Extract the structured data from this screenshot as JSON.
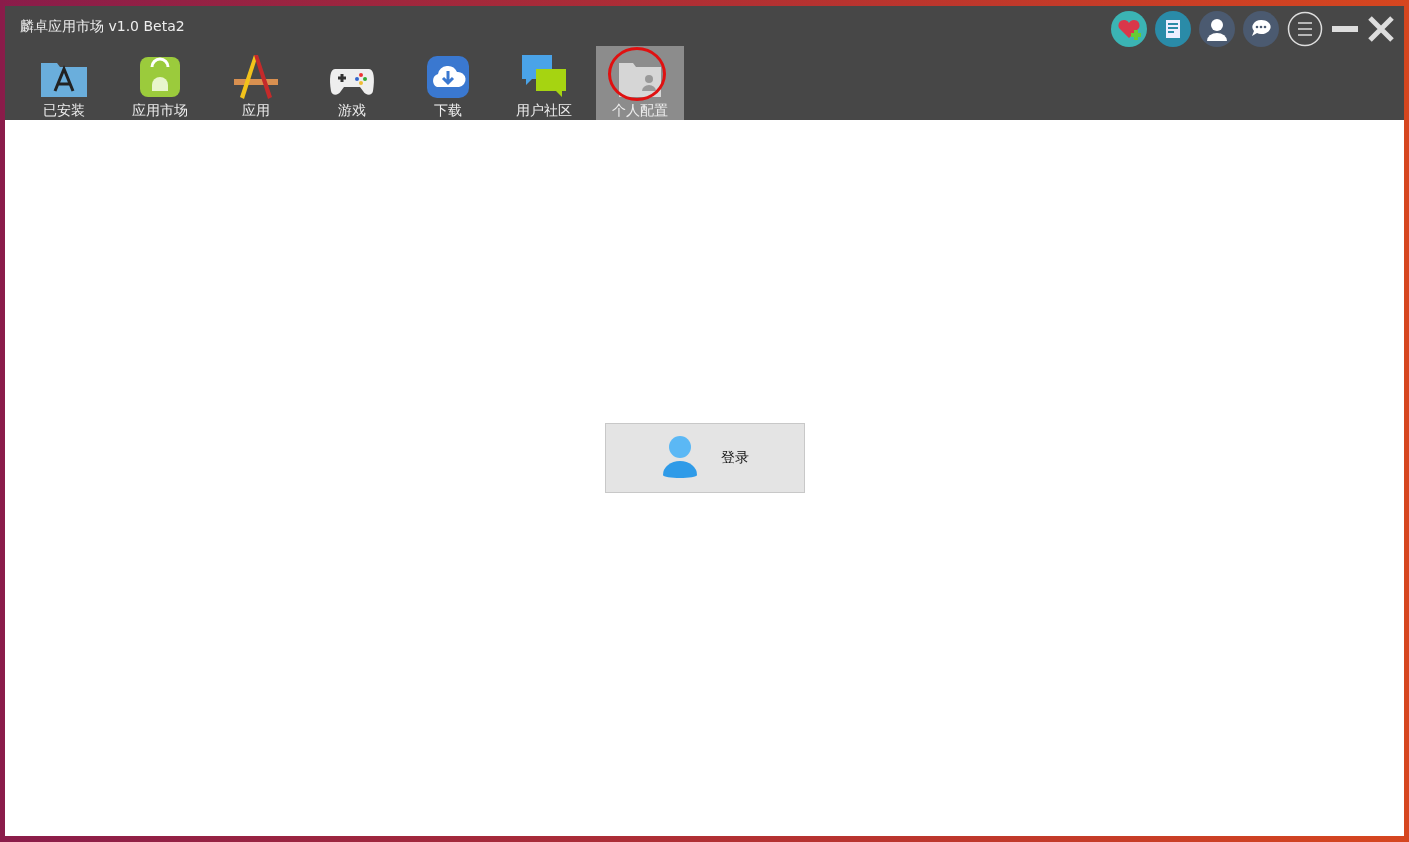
{
  "window": {
    "title": "麟卓应用市场  v1.0 Beta2"
  },
  "tabs": [
    {
      "label": "已安装",
      "kind": "installed",
      "selected": false
    },
    {
      "label": "应用市场",
      "kind": "market",
      "selected": false
    },
    {
      "label": "应用",
      "kind": "apps",
      "selected": false
    },
    {
      "label": "游戏",
      "kind": "games",
      "selected": false
    },
    {
      "label": "下载",
      "kind": "download",
      "selected": false
    },
    {
      "label": "用户社区",
      "kind": "community",
      "selected": false
    },
    {
      "label": "个人配置",
      "kind": "profile",
      "selected": true,
      "circled": true
    }
  ],
  "header_buttons": [
    {
      "kind": "health"
    },
    {
      "kind": "news"
    },
    {
      "kind": "user"
    },
    {
      "kind": "chat"
    },
    {
      "kind": "menu"
    },
    {
      "kind": "minimize"
    },
    {
      "kind": "close"
    }
  ],
  "login_button": {
    "label": "登录"
  }
}
